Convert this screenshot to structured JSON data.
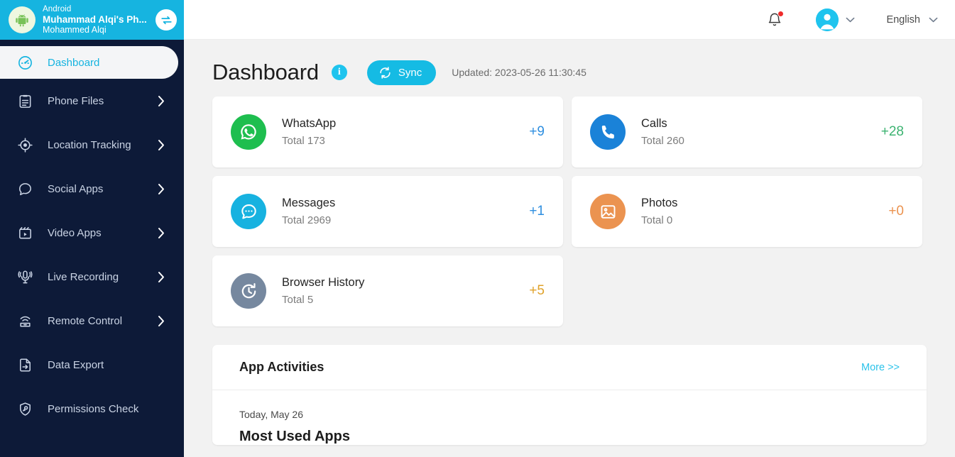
{
  "device": {
    "os": "Android",
    "name": "Muhammad Alqi's Ph...",
    "user": "Mohammed Alqi",
    "switch_icon": "switch-device-icon",
    "android_icon": "android-icon",
    "header_color": "#16b4e0"
  },
  "sidebar": {
    "background": "#0d1a38",
    "active_color": "#16b4e0",
    "items": [
      {
        "label": "Dashboard",
        "icon": "dashboard-icon",
        "active": true,
        "chevron": false
      },
      {
        "label": "Phone Files",
        "icon": "phone-files-icon",
        "active": false,
        "chevron": true
      },
      {
        "label": "Location Tracking",
        "icon": "location-tracking-icon",
        "active": false,
        "chevron": true
      },
      {
        "label": "Social Apps",
        "icon": "social-apps-icon",
        "active": false,
        "chevron": true
      },
      {
        "label": "Video Apps",
        "icon": "video-apps-icon",
        "active": false,
        "chevron": true
      },
      {
        "label": "Live Recording",
        "icon": "live-recording-icon",
        "active": false,
        "chevron": true
      },
      {
        "label": "Remote Control",
        "icon": "remote-control-icon",
        "active": false,
        "chevron": true
      },
      {
        "label": "Data Export",
        "icon": "data-export-icon",
        "active": false,
        "chevron": false
      },
      {
        "label": "Permissions Check",
        "icon": "permissions-check-icon",
        "active": false,
        "chevron": false
      }
    ]
  },
  "topbar": {
    "notification_icon": "bell-icon",
    "has_notification_dot": true,
    "avatar_icon": "user-avatar-icon",
    "language": "English",
    "chevron_icon": "chevron-down-icon"
  },
  "page": {
    "title": "Dashboard",
    "info_icon": "info-icon",
    "info_glyph": "i",
    "sync_label": "Sync",
    "sync_icon": "sync-icon",
    "updated": "Updated: 2023-05-26 11:30:45"
  },
  "cards": [
    {
      "name": "WhatsApp",
      "total": "Total 173",
      "delta": "+9",
      "icon": "whatsapp-icon",
      "icon_bg": "#1ebe4f",
      "delta_color": "#2f8fe0"
    },
    {
      "name": "Calls",
      "total": "Total 260",
      "delta": "+28",
      "icon": "phone-call-icon",
      "icon_bg": "#1a82d8",
      "delta_color": "#3cb371"
    },
    {
      "name": "Messages",
      "total": "Total 2969",
      "delta": "+1",
      "icon": "messages-icon",
      "icon_bg": "#17b2e0",
      "delta_color": "#2f8fe0"
    },
    {
      "name": "Photos",
      "total": "Total 0",
      "delta": "+0",
      "icon": "photos-icon",
      "icon_bg": "#eb9350",
      "delta_color": "#eb9350"
    },
    {
      "name": "Browser History",
      "total": "Total 5",
      "delta": "+5",
      "icon": "browser-history-icon",
      "icon_bg": "#76889f",
      "delta_color": "#e0a22a"
    }
  ],
  "activities": {
    "title": "App Activities",
    "more_label": "More >>",
    "day": "Today, May 26",
    "section": "Most Used Apps"
  }
}
